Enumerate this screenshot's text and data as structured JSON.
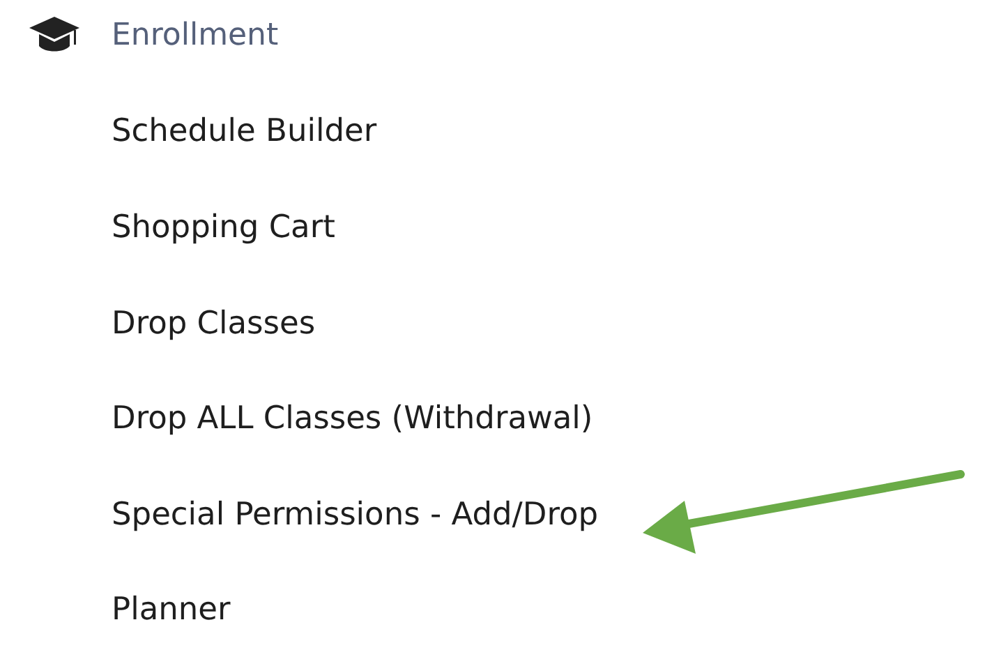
{
  "section": {
    "title": "Enrollment"
  },
  "items": [
    {
      "label": "Schedule Builder",
      "pointed": false
    },
    {
      "label": "Shopping Cart",
      "pointed": false
    },
    {
      "label": "Drop Classes",
      "pointed": false
    },
    {
      "label": "Drop ALL Classes (Withdrawal)",
      "pointed": false
    },
    {
      "label": "Special Permissions - Add/Drop",
      "pointed": true
    },
    {
      "label": "Planner",
      "pointed": false
    }
  ]
}
